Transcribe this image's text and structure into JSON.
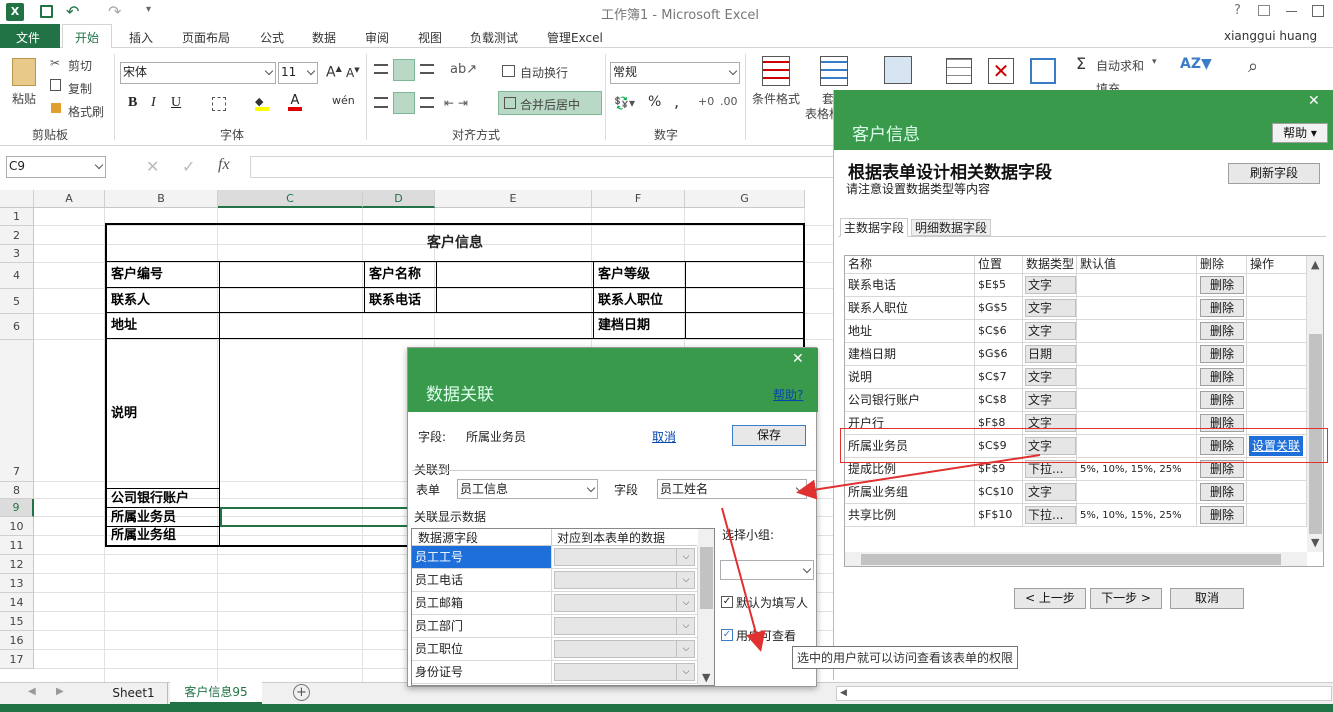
{
  "app": {
    "title": "工作簿1 - Microsoft Excel",
    "user": "xianggui huang"
  },
  "menu": {
    "file": "文件",
    "tabs": [
      "开始",
      "插入",
      "页面布局",
      "公式",
      "数据",
      "审阅",
      "视图",
      "负载测试",
      "管理Excel"
    ]
  },
  "ribbon": {
    "paste": "粘贴",
    "cut": "剪切",
    "copy": "复制",
    "format_painter": "格式刷",
    "clipboard": "剪贴板",
    "font_name": "宋体",
    "font_size": "11",
    "font_group": "字体",
    "wrap": "自动换行",
    "merge": "合并后居中",
    "align_group": "对齐方式",
    "num_format": "常规",
    "number_group": "数字",
    "cond_format": "条件格式",
    "table_fmt_1": "套",
    "table_fmt_2": "表格格",
    "autosum": "自动求和",
    "fill": "填充",
    "bold": "B",
    "italic": "I",
    "underline": "U",
    "percent": "%",
    "comma": ",",
    "phonetic": "wén"
  },
  "formula": {
    "namebox": "C9",
    "fx": "fx"
  },
  "grid": {
    "columns": [
      "A",
      "B",
      "C",
      "D",
      "E",
      "F",
      "G"
    ],
    "rows": [
      "1",
      "2",
      "3",
      "4",
      "5",
      "6",
      "7",
      "8",
      "9",
      "10",
      "11",
      "12",
      "13",
      "14",
      "15",
      "16",
      "17"
    ],
    "title": "客户信息",
    "cells": {
      "r4": [
        "客户编号",
        "客户名称",
        "客户等级"
      ],
      "r5": [
        "联系人",
        "联系电话",
        "联系人职位"
      ],
      "r6": [
        "地址",
        "建档日期"
      ],
      "r7": "说明",
      "r8": "公司银行账户",
      "r9": "所属业务员",
      "r10": "所属业务组"
    }
  },
  "sheets": {
    "sheet1": "Sheet1",
    "sheet2": "客户信息95"
  },
  "side_panel": {
    "title": "客户信息",
    "help": "帮助",
    "heading": "根据表单设计相关数据字段",
    "subheading": "请注意设置数据类型等内容",
    "refresh": "刷新字段",
    "tabs": [
      "主数据字段",
      "明细数据字段"
    ],
    "columns": [
      "名称",
      "位置",
      "数据类型",
      "默认值",
      "删除",
      "操作"
    ],
    "rows": [
      {
        "name": "联系电话",
        "pos": "$E$5",
        "type": "文字",
        "default": "",
        "del": "删除",
        "op": ""
      },
      {
        "name": "联系人职位",
        "pos": "$G$5",
        "type": "文字",
        "default": "",
        "del": "删除",
        "op": ""
      },
      {
        "name": "地址",
        "pos": "$C$6",
        "type": "文字",
        "default": "",
        "del": "删除",
        "op": ""
      },
      {
        "name": "建档日期",
        "pos": "$G$6",
        "type": "日期",
        "default": "",
        "del": "删除",
        "op": ""
      },
      {
        "name": "说明",
        "pos": "$C$7",
        "type": "文字",
        "default": "",
        "del": "删除",
        "op": ""
      },
      {
        "name": "公司银行账户",
        "pos": "$C$8",
        "type": "文字",
        "default": "",
        "del": "删除",
        "op": ""
      },
      {
        "name": "开户行",
        "pos": "$F$8",
        "type": "文字",
        "default": "",
        "del": "删除",
        "op": ""
      },
      {
        "name": "所属业务员",
        "pos": "$C$9",
        "type": "文字",
        "default": "",
        "del": "删除",
        "op": "设置关联"
      },
      {
        "name": "提成比例",
        "pos": "$F$9",
        "type": "下拉...",
        "default": "5%, 10%, 15%, 25%",
        "del": "删除",
        "op": ""
      },
      {
        "name": "所属业务组",
        "pos": "$C$10",
        "type": "文字",
        "default": "",
        "del": "删除",
        "op": ""
      },
      {
        "name": "共享比例",
        "pos": "$F$10",
        "type": "下拉...",
        "default": "5%, 10%, 15%, 25%",
        "del": "删除",
        "op": ""
      }
    ],
    "prev": "< 上一步",
    "next": "下一步 >",
    "cancel": "取消"
  },
  "dialog": {
    "title": "数据关联",
    "help": "帮助?",
    "field_label": "字段:",
    "field_value": "所属业务员",
    "cancel": "取消",
    "save": "保存",
    "link_group": "关联到",
    "form_label": "表单",
    "form_value": "员工信息",
    "field2_label": "字段",
    "field2_value": "员工姓名",
    "display_group": "关联显示数据",
    "col1": "数据源字段",
    "col2": "对应到本表单的数据",
    "items": [
      "员工工号",
      "员工电话",
      "员工邮箱",
      "员工部门",
      "员工职位",
      "身份证号"
    ],
    "group_label": "选择小组:",
    "chk1": "默认为填写人",
    "chk2": "用户可查看",
    "tooltip": "选中的用户就可以访问查看该表单的权限"
  }
}
